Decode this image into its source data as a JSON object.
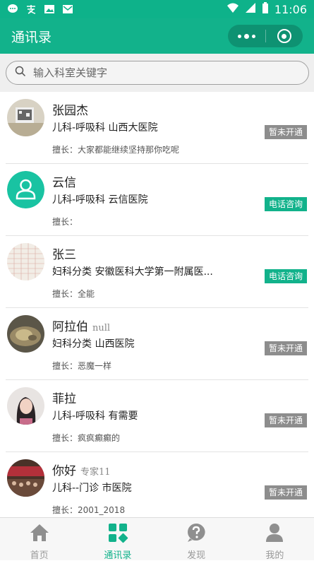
{
  "status_bar": {
    "time": "11:06",
    "left_icons": [
      "chat-bubble-icon",
      "alipay-icon",
      "image-icon",
      "mail-icon"
    ],
    "right_icons": [
      "wifi-icon",
      "signal-icon",
      "battery-icon"
    ]
  },
  "nav": {
    "title": "通讯录",
    "capsule_icons": [
      "more-dots-icon",
      "close-target-icon"
    ]
  },
  "search": {
    "placeholder": "输入科室关键字",
    "value": ""
  },
  "contacts": [
    {
      "name": "张园杰",
      "extra": "",
      "dept": "儿科-呼吸科  山西大医院",
      "skill": "擅长：大家都能继续坚持那你吃呢",
      "status": "暂未开通",
      "status_type": "gray",
      "avatar": "photo-avatar"
    },
    {
      "name": "云信",
      "extra": "",
      "dept": "儿科-呼吸科  云信医院",
      "skill": "擅长：",
      "status": "电话咨询",
      "status_type": "green",
      "avatar": "default-user-avatar"
    },
    {
      "name": "张三",
      "extra": "",
      "dept": "妇科分类  安徽医科大学第一附属医...",
      "skill": "擅长：全能",
      "status": "电话咨询",
      "status_type": "green",
      "avatar": "photo-avatar"
    },
    {
      "name": "阿拉伯",
      "extra": "null",
      "dept": "妇科分类  山西医院",
      "skill": "擅长：恶魔一样",
      "status": "暂未开通",
      "status_type": "gray",
      "avatar": "photo-avatar"
    },
    {
      "name": "菲拉",
      "extra": "",
      "dept": "儿科-呼吸科  有需要",
      "skill": "擅长：疯疯癫癫的",
      "status": "暂未开通",
      "status_type": "gray",
      "avatar": "photo-avatar"
    },
    {
      "name": "你好",
      "extra": "专家11",
      "dept": "儿科--门诊  市医院",
      "skill": "擅长：2001_2018",
      "status": "暂未开通",
      "status_type": "gray",
      "avatar": "photo-avatar"
    }
  ],
  "tabs": [
    {
      "label": "首页",
      "icon": "home-icon",
      "active": false
    },
    {
      "label": "通讯录",
      "icon": "contacts-grid-icon",
      "active": true
    },
    {
      "label": "发现",
      "icon": "question-icon",
      "active": false
    },
    {
      "label": "我的",
      "icon": "user-icon",
      "active": false
    }
  ],
  "colors": {
    "brand": "#12b28b",
    "inactive_badge": "#8d8d8d",
    "tab_inactive": "#999999"
  }
}
